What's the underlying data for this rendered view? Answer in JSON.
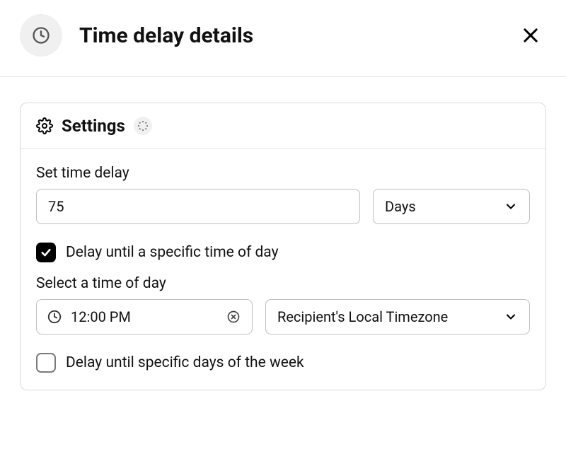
{
  "header": {
    "title": "Time delay details"
  },
  "settings": {
    "card_title": "Settings",
    "set_delay_label": "Set time delay",
    "delay_value": "75",
    "delay_unit_selected": "Days",
    "delay_time_checkbox_label": "Delay until a specific time of day",
    "delay_time_checked": true,
    "select_time_label": "Select a time of day",
    "time_value": "12:00 PM",
    "timezone_selected": "Recipient's Local Timezone",
    "delay_days_checkbox_label": "Delay until specific days of the week",
    "delay_days_checked": false
  }
}
